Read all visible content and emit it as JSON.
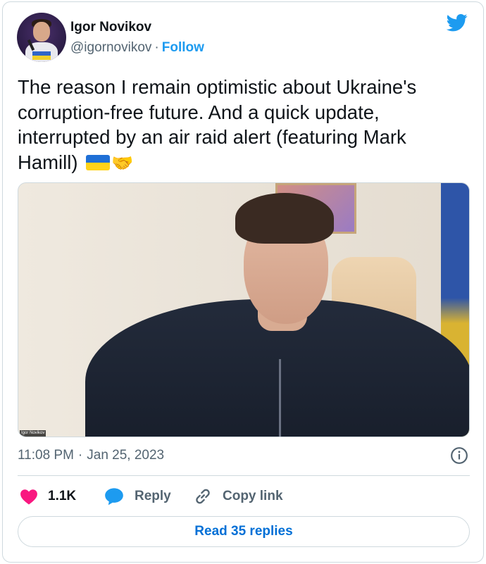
{
  "author": {
    "name": "Igor Novikov",
    "handle": "@igornovikov",
    "separator": "·",
    "follow_label": "Follow"
  },
  "tweet": {
    "text": "The reason I remain optimistic about Ukraine's corruption-free future. And a quick update, interrupted by an air raid alert (featuring Mark Hamill)",
    "emojis": [
      "ukraine-flag",
      "handshake"
    ]
  },
  "media": {
    "type": "video-still",
    "nameplate": "Igor Novikov"
  },
  "meta": {
    "time": "11:08 PM",
    "separator": "·",
    "date": "Jan 25, 2023"
  },
  "actions": {
    "like_count": "1.1K",
    "reply_label": "Reply",
    "copy_link_label": "Copy link"
  },
  "read_replies_label": "Read 35 replies",
  "colors": {
    "twitter_blue": "#1d9bf0",
    "like_pink": "#f91880",
    "text_primary": "#0f1419",
    "text_secondary": "#536471",
    "border": "#cfd9de",
    "link_blue": "#006fd6"
  },
  "icons": [
    "twitter-bird-icon",
    "info-icon",
    "heart-icon",
    "reply-bubble-icon",
    "link-icon"
  ]
}
